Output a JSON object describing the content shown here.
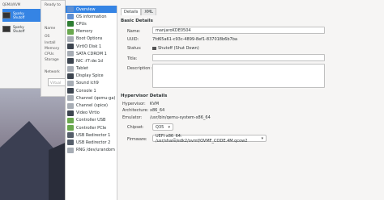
{
  "background_window": {
    "connection": "QEMU/KVM",
    "vms": [
      {
        "name": "Sparky",
        "state": "Shutoff"
      },
      {
        "name": "Sparky",
        "state": "Shutoff"
      }
    ]
  },
  "dialog_behind": {
    "lines": [
      "Ready to",
      "",
      "Name",
      "OS",
      "Install",
      "Memory",
      "CPUs",
      "Storage",
      "Network",
      "Virtual"
    ]
  },
  "details": {
    "tabs": [
      {
        "label": "Details",
        "active": true
      },
      {
        "label": "XML",
        "active": false
      }
    ],
    "sidebar": [
      {
        "label": "Overview",
        "icon": "info-icon",
        "selected": true
      },
      {
        "label": "OS information",
        "icon": "info-icon"
      },
      {
        "label": "CPUs",
        "icon": "cpu-icon"
      },
      {
        "label": "Memory",
        "icon": "memory-icon"
      },
      {
        "label": "Boot Options",
        "icon": "boot-icon"
      },
      {
        "label": "VirtIO Disk 1",
        "icon": "disk-icon"
      },
      {
        "label": "SATA CDROM 1",
        "icon": "cdrom-icon"
      },
      {
        "label": "NIC :f7:de:1d",
        "icon": "network-icon"
      },
      {
        "label": "Tablet",
        "icon": "tablet-icon"
      },
      {
        "label": "Display Spice",
        "icon": "display-icon"
      },
      {
        "label": "Sound ich9",
        "icon": "sound-icon"
      },
      {
        "label": "Console 1",
        "icon": "console-icon"
      },
      {
        "label": "Channel (qemu-ga)",
        "icon": "channel-icon"
      },
      {
        "label": "Channel (spice)",
        "icon": "channel-icon"
      },
      {
        "label": "Video Virtio",
        "icon": "video-icon"
      },
      {
        "label": "Controller USB",
        "icon": "controller-icon"
      },
      {
        "label": "Controller PCIe",
        "icon": "controller-icon"
      },
      {
        "label": "USB Redirector 1",
        "icon": "usb-icon"
      },
      {
        "label": "USB Redirector 2",
        "icon": "usb-icon"
      },
      {
        "label": "RNG /dev/urandom",
        "icon": "rng-icon"
      }
    ],
    "basic": {
      "heading": "Basic Details",
      "name_label": "Name:",
      "name_value": "manjaroKDE0504",
      "uuid_label": "UUID:",
      "uuid_value": "7fd65a61-c93c-4899-8ef1-837018b6b7ba",
      "status_label": "Status:",
      "status_value": "Shutoff (Shut Down)",
      "title_label": "Title:",
      "title_value": "",
      "description_label": "Description:"
    },
    "hypervisor": {
      "heading": "Hypervisor Details",
      "hypervisor_label": "Hypervisor:",
      "hypervisor_value": "KVM",
      "arch_label": "Architecture:",
      "arch_value": "x86_64",
      "emulator_label": "Emulator:",
      "emulator_value": "/usr/bin/qemu-system-x86_64",
      "chipset_label": "Chipset:",
      "chipset_value": "Q35",
      "firmware_label": "Firmware:",
      "firmware_value": "UEFI x86_64: /usr/share/edk2/ovmf/OVMF_CODE.4M.qcow2"
    }
  }
}
